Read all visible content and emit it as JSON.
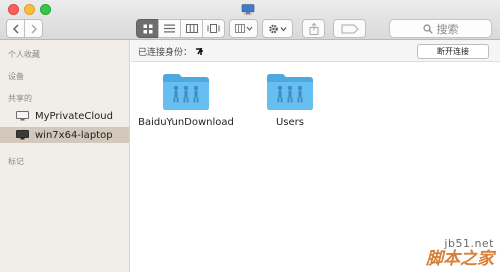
{
  "toolbar": {
    "search_placeholder": "搜索",
    "search_icon": "magnifier-icon",
    "back_icon": "chevron-left-icon",
    "forward_icon": "chevron-right-icon"
  },
  "sidebar": {
    "sections": [
      {
        "label": "个人收藏"
      },
      {
        "label": "设备"
      },
      {
        "label": "共享的"
      },
      {
        "label": "标记"
      }
    ],
    "shared_items": [
      {
        "label": "MyPrivateCloud",
        "icon": "monitor-icon"
      },
      {
        "label": "win7x64-laptop",
        "icon": "monitor-icon",
        "selected": true
      }
    ]
  },
  "pathbar": {
    "connected_as": "已连接身份：",
    "disconnect_label": "断开连接"
  },
  "content": {
    "items": [
      {
        "name": "BaiduYunDownload",
        "icon": "shared-folder-icon"
      },
      {
        "name": "Users",
        "icon": "shared-folder-icon"
      }
    ]
  },
  "watermark": {
    "url": "jb51.net",
    "name": "脚本之家"
  },
  "colors": {
    "folder": "#5fb8ea",
    "selection": "#d2c8bc",
    "watermark_orange": "#d87f38"
  }
}
